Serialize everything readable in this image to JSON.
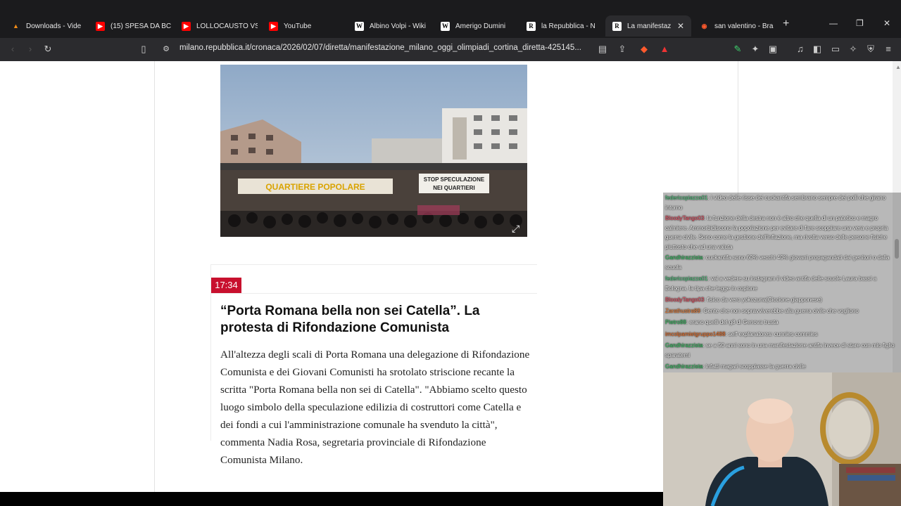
{
  "tabs": [
    {
      "label": "Downloads - Vide",
      "icon": "vlc-icon",
      "color": "#f28c18"
    },
    {
      "label": "(15) SPESA DA BC",
      "icon": "youtube-icon",
      "color": "#ff0000"
    },
    {
      "label": "LOLLOCAUSTO VS",
      "icon": "youtube-icon",
      "color": "#ff0000"
    },
    {
      "label": "YouTube",
      "icon": "youtube-icon",
      "color": "#ff0000"
    },
    {
      "label": "Albino Volpi - Wiki",
      "icon": "wikipedia-icon",
      "color": "#ffffff"
    },
    {
      "label": "Amerigo Dumini",
      "icon": "wikipedia-icon",
      "color": "#ffffff"
    },
    {
      "label": "la Repubblica - N",
      "icon": "repubblica-icon",
      "color": "#ffffff"
    },
    {
      "label": "La manifestaz",
      "icon": "repubblica-icon",
      "color": "#ffffff"
    },
    {
      "label": "san valentino - Bra",
      "icon": "brave-icon",
      "color": "#ff5a2d"
    }
  ],
  "url": {
    "host": "milano.repubblica.it",
    "path": "/cronaca/2026/02/07/diretta/manifestazione_milano_oggi_olimpiadi_cortina_diretta-425145..."
  },
  "entry": {
    "time": "17:34",
    "headline": "“Porta Romana bella non sei Catella”. La protesta di Rifondazione Comunista",
    "body": "All'altezza degli scali di Porta Romana una delegazione di Rifondazione Comunista e dei Giovani Comunisti ha srotolato striscione recante la scritta \"Porta Romana bella non sei di Catella\". \"Abbiamo scelto questo luogo simbolo della speculazione edilizia di costruttori come Catella e dei fondi a cui l'amministrazione comunale ha svenduto la città\", commenta Nadia Rosa, segretaria provinciale di Rifondazione Comunista Milano."
  },
  "photo_banners": {
    "left": "QUARTIERE POPOLARE",
    "right_line1": "STOP SPECULAZIONE",
    "right_line2": "NEI QUARTIERI"
  },
  "chat": [
    {
      "user": "federicopiazza01",
      "color": "#5ad38a",
      "text": ": i video delle risse dei cuckantifa sembrano sempre dei polli che girano intorno"
    },
    {
      "user": "BloodyTango03",
      "color": "#ff5a6e",
      "text": ": la funzione della destra non è altro che quella di un patetico e magro calmiere. Ammorbidiscono la popolazione per evitare di fare scoppiare una vera e propria guerra civile. Sono come la gestione dell'inflazione, ma rivolta verso delle persone fisiche piuttosto che ad una valuta"
    },
    {
      "user": "Gandhirazzista",
      "color": "#3ecf6c",
      "text": ": cuckantifa sono 60% vecchi 40% giovani propagandati dai genitori o dalla scuola"
    },
    {
      "user": "federicopiazza01",
      "color": "#5ad38a",
      "text": ": vai a vedere su instagram il video antifa delle scuole Laura bassi a Bologna. la tipa che legge in copione"
    },
    {
      "user": "BloodyTango03",
      "color": "#ff5a6e",
      "text": ": fisico da vero yokozuna(Ciccione giapponese)"
    },
    {
      "user": "Zarathustra89",
      "color": "#ff8a3d",
      "text": ": Gente che non sopravviverebbe alla guerra civile che vogliono"
    },
    {
      "user": "Pietro88",
      "color": "#3ecf6c",
      "text": ": erano quelli del g8 di Genova trusta"
    },
    {
      "user": "imcolpamietgruppo1488",
      "color": "#ff7a2d",
      "text": ": self explanatores: cunnies commies"
    },
    {
      "user": "Gandhirazzista",
      "color": "#3ecf6c",
      "text": ": se a 50 anni sono in una manifestazione antifa invece di stare con mio figlio sparatemi"
    },
    {
      "user": "Gandhirazzista",
      "color": "#3ecf6c",
      "text": ": infatti magari scoppiasse la guerra civile"
    }
  ]
}
